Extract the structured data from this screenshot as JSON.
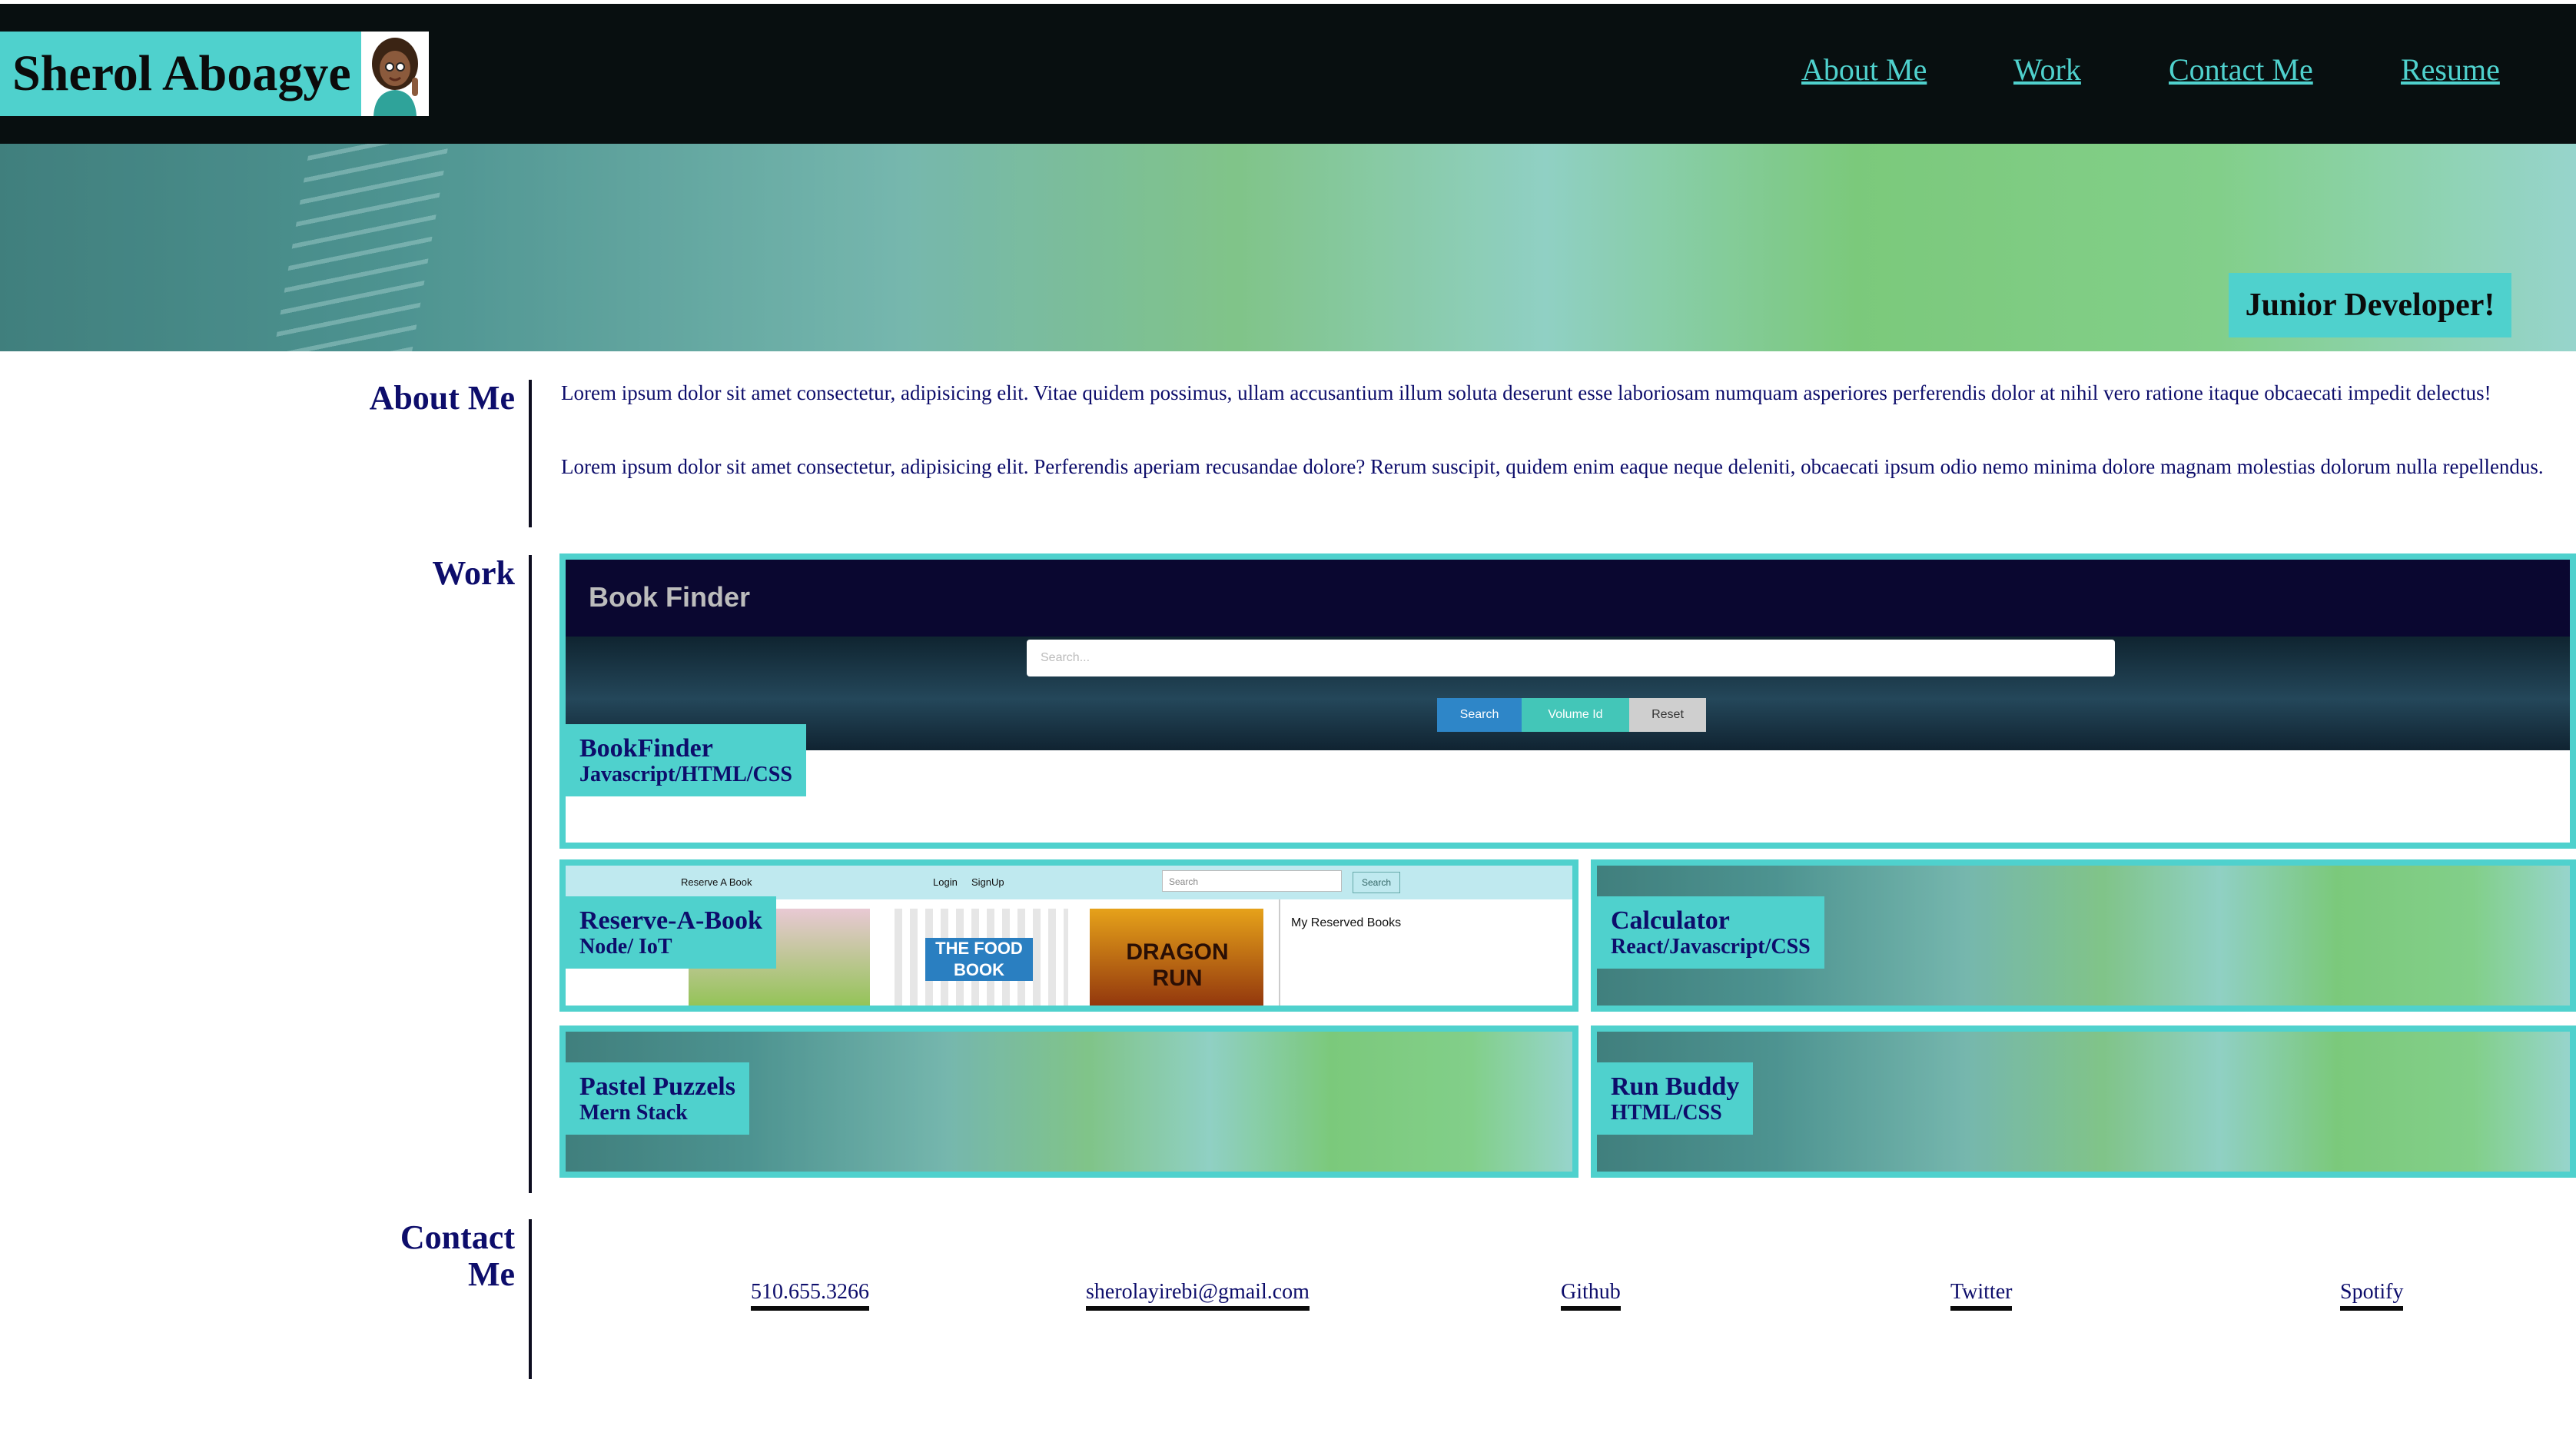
{
  "header": {
    "brand_name": "Sherol Aboagye",
    "nav": [
      "About Me",
      "Work",
      "Contact Me",
      "Resume"
    ]
  },
  "hero": {
    "tagline": "Junior Developer!"
  },
  "about": {
    "title": "About Me",
    "paragraphs": [
      "Lorem ipsum dolor sit amet consectetur, adipisicing elit. Vitae quidem possimus, ullam accusantium illum soluta deserunt esse laboriosam numquam asperiores perferendis dolor at nihil vero ratione itaque obcaecati impedit delectus!",
      "Lorem ipsum dolor sit amet consectetur, adipisicing elit. Perferendis aperiam recusandae dolore? Rerum suscipit, quidem enim eaque neque deleniti, obcaecati ipsum odio nemo minima dolore magnam molestias dolorum nulla repellendus."
    ]
  },
  "work": {
    "title": "Work",
    "projects": [
      {
        "name": "BookFinder",
        "tech": "Javascript/HTML/CSS"
      },
      {
        "name": "Reserve-A-Book",
        "tech": "Node/ IoT"
      },
      {
        "name": "Calculator",
        "tech": "React/Javascript/CSS"
      },
      {
        "name": "Pastel Puzzels",
        "tech": "Mern Stack"
      },
      {
        "name": "Run Buddy",
        "tech": "HTML/CSS"
      }
    ],
    "bookfinder_screenshot": {
      "title": "Book Finder",
      "search_placeholder": "Search...",
      "buttons": [
        "Search",
        "Volume Id",
        "Reset"
      ]
    },
    "reserve_screenshot": {
      "brand": "Reserve A Book",
      "login": "Login",
      "signup": "SignUp",
      "search_placeholder": "Search",
      "search_button": "Search",
      "sidebar_title": "My Reserved Books",
      "book_titles": [
        "THE FOOD BOOK",
        "DRAGON RUN"
      ]
    }
  },
  "contact": {
    "title": "Contact Me",
    "links": [
      "510.655.3266",
      "sherolayirebi@gmail.com",
      "Github",
      "Twitter",
      "Spotify"
    ]
  },
  "colors": {
    "accent": "#4fd1cd",
    "header_bg": "#080f10",
    "text": "#0d0d6b"
  }
}
